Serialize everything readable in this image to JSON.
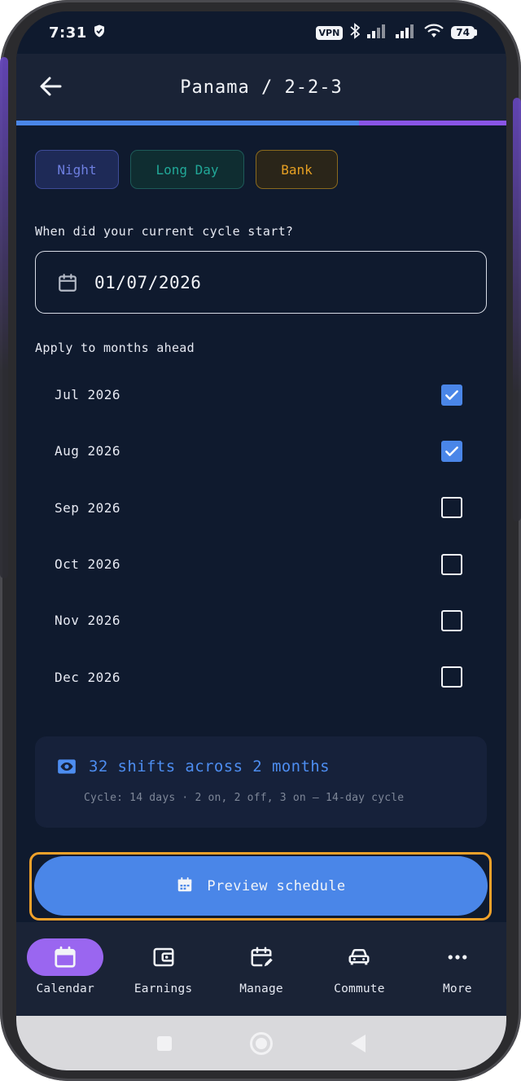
{
  "status_bar": {
    "time": "7:31",
    "vpn_label": "VPN",
    "battery_level": "74"
  },
  "header": {
    "title": "Panama / 2-2-3",
    "progress_fraction": 0.7
  },
  "shift_chips": [
    {
      "label": "Night",
      "color": "#6e7fe0"
    },
    {
      "label": "Long Day",
      "color": "#21a898"
    },
    {
      "label": "Bank",
      "color": "#e6a023"
    }
  ],
  "cycle_start": {
    "label": "When did your current cycle start?",
    "value": "01/07/2026"
  },
  "months": {
    "label": "Apply to months ahead",
    "items": [
      {
        "label": "Jul 2026",
        "checked": true
      },
      {
        "label": "Aug 2026",
        "checked": true
      },
      {
        "label": "Sep 2026",
        "checked": false
      },
      {
        "label": "Oct 2026",
        "checked": false
      },
      {
        "label": "Nov 2026",
        "checked": false
      },
      {
        "label": "Dec 2026",
        "checked": false
      }
    ]
  },
  "summary": {
    "title": "32 shifts across 2 months",
    "subtitle": "Cycle: 14 days · 2 on, 2 off, 3 on — 14-day cycle"
  },
  "preview_button": {
    "label": "Preview schedule"
  },
  "bottom_nav": {
    "items": [
      {
        "label": "Calendar",
        "icon": "calendar-icon",
        "active": true
      },
      {
        "label": "Earnings",
        "icon": "wallet-icon",
        "active": false
      },
      {
        "label": "Manage",
        "icon": "calendar-edit-icon",
        "active": false
      },
      {
        "label": "Commute",
        "icon": "car-icon",
        "active": false
      },
      {
        "label": "More",
        "icon": "more-icon",
        "active": false
      }
    ]
  },
  "colors": {
    "accent": "#4a86e8",
    "accent_purple": "#9a66f0",
    "highlight_outline": "#f0a12a",
    "background": "#0f1a2e"
  }
}
